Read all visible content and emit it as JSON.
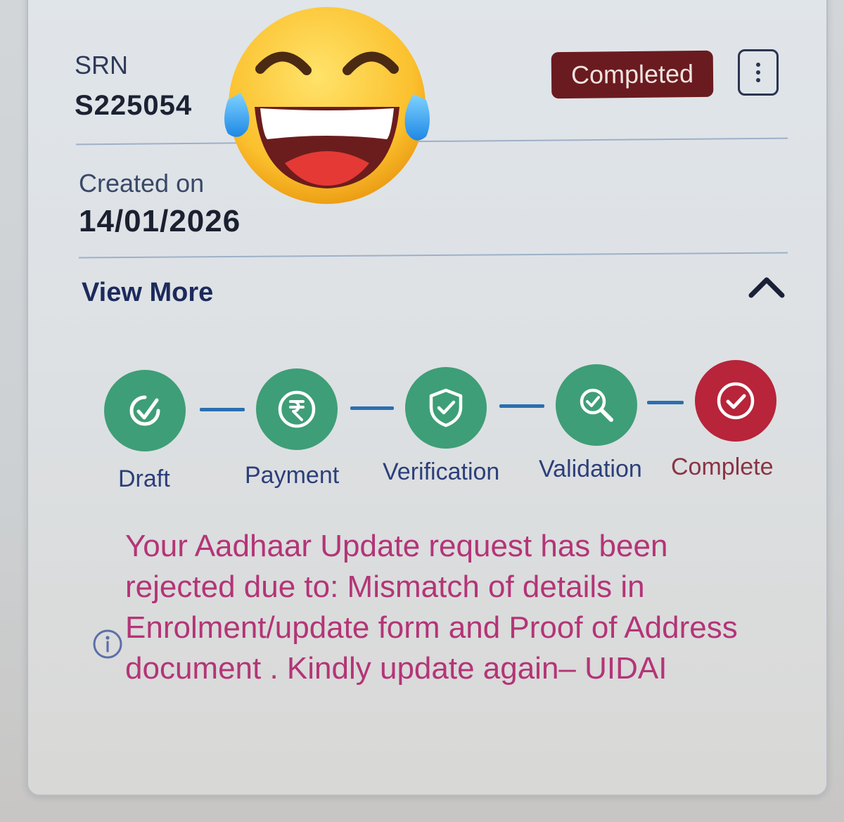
{
  "header": {
    "srn_label": "SRN",
    "srn_value": "S225054",
    "status": "Completed",
    "more_icon": "kebab-menu-icon"
  },
  "created": {
    "label": "Created on",
    "date": "14/01/2026"
  },
  "toggle": {
    "label": "View More",
    "icon": "chevron-up-icon"
  },
  "steps": [
    {
      "label": "Draft",
      "icon": "draft-check-icon",
      "color": "#3e9e77"
    },
    {
      "label": "Payment",
      "icon": "rupee-icon",
      "color": "#3e9e77"
    },
    {
      "label": "Verification",
      "icon": "shield-check-icon",
      "color": "#3e9e77"
    },
    {
      "label": "Validation",
      "icon": "magnifier-check-icon",
      "color": "#3e9e77"
    },
    {
      "label": "Complete",
      "icon": "circle-check-icon",
      "color": "#b8243a"
    }
  ],
  "message": {
    "icon": "info-icon",
    "text": "Your Aadhaar Update request has been rejected due to: Mismatch of details in Enrolment/update form and Proof of Address document . Kindly update again– UIDAI"
  },
  "overlay": {
    "emoji": "face-with-tears-of-joy-emoji"
  },
  "colors": {
    "status_badge": "#6a1b1f",
    "step_done": "#3e9e77",
    "step_final": "#b8243a",
    "message": "#b43477",
    "link": "#1c2a5c"
  }
}
